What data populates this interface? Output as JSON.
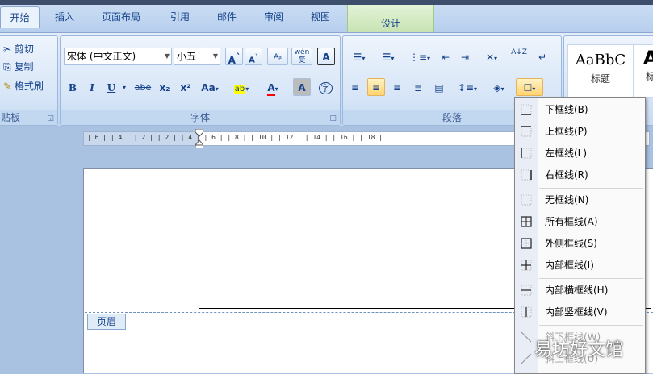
{
  "tabs": [
    {
      "label": "开始",
      "active": true
    },
    {
      "label": "插入"
    },
    {
      "label": "页面布局"
    },
    {
      "label": "引用"
    },
    {
      "label": "邮件"
    },
    {
      "label": "审阅"
    },
    {
      "label": "视图"
    }
  ],
  "context_tab": {
    "label": "设计"
  },
  "clipboard": {
    "cut": "剪切",
    "copy": "复制",
    "format_painter": "格式刷",
    "group_label": "贴板"
  },
  "font": {
    "font_name": "宋体 (中文正文)",
    "font_size": "小五",
    "grow": "A",
    "shrink": "A",
    "phonetic": "wén",
    "bold": "B",
    "italic": "I",
    "underline": "U",
    "strike": "abe",
    "subscript": "x₂",
    "superscript": "x²",
    "change_case": "Aa",
    "highlight": "ab",
    "font_color": "A",
    "char_shading": "A",
    "enclose": "字",
    "group_label": "字体"
  },
  "paragraph": {
    "sort": "A↓Z",
    "group_label": "段落"
  },
  "styles": {
    "heading_sample": "AaBbC",
    "heading_label": "标题",
    "next_sample": "A",
    "next_label": "标"
  },
  "ruler": {
    "text": "| 6 |   | 4 |   | 2 |       | 2 |   | 4 |   | 6 |   | 8 |   | 10 |  | 12 |  | 14 |  | 16 |  | 18 |"
  },
  "document": {
    "header_tag": "页眉"
  },
  "border_menu": {
    "items": [
      {
        "label": "下框线(B)",
        "icon": "border-bottom-icon"
      },
      {
        "label": "上框线(P)",
        "icon": "border-top-icon"
      },
      {
        "label": "左框线(L)",
        "icon": "border-left-icon"
      },
      {
        "label": "右框线(R)",
        "icon": "border-right-icon"
      },
      {
        "label": "无框线(N)",
        "icon": "border-none-icon"
      },
      {
        "label": "所有框线(A)",
        "icon": "border-all-icon"
      },
      {
        "label": "外侧框线(S)",
        "icon": "border-outside-icon"
      },
      {
        "label": "内部框线(I)",
        "icon": "border-inside-icon"
      },
      {
        "label": "内部横框线(H)",
        "icon": "border-inside-horizontal-icon"
      },
      {
        "label": "内部竖框线(V)",
        "icon": "border-inside-vertical-icon"
      },
      {
        "label": "斜下框线(W)",
        "icon": "border-diagonal-down-icon"
      },
      {
        "label": "斜上框线(U)",
        "icon": "border-diagonal-up-icon"
      }
    ]
  },
  "watermark": "易坊好文馆",
  "colors": {
    "ribbon_text": "#15428b",
    "highlight": "#ffd36f",
    "highlight_yellow": "#ffff00",
    "font_color_red": "#ff0000"
  }
}
